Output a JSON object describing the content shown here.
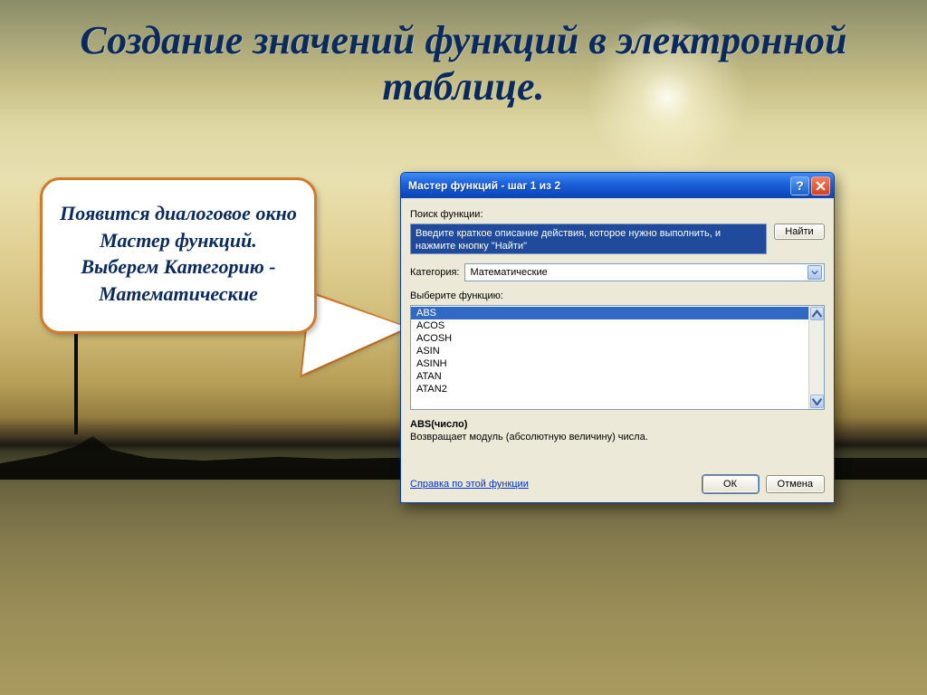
{
  "slide": {
    "title": "Создание значений функций в электронной таблице."
  },
  "bubble": {
    "text": "Появится диалоговое окно Мастер функций. Выберем Категорию - Математические"
  },
  "dialog": {
    "title": "Мастер функций - шаг 1 из 2",
    "search_label": "Поиск функции:",
    "search_text": "Введите краткое описание действия, которое нужно выполнить, и нажмите кнопку \"Найти\"",
    "find_button": "Найти",
    "category_label": "Категория:",
    "category_value": "Математические",
    "select_label": "Выберите функцию:",
    "functions": [
      "ABS",
      "ACOS",
      "ACOSH",
      "ASIN",
      "ASINH",
      "ATAN",
      "ATAN2"
    ],
    "selected_function_index": 0,
    "desc_title": "ABS(число)",
    "desc_text": "Возвращает модуль (абсолютную величину) числа.",
    "help_link": "Справка по этой функции",
    "ok": "ОК",
    "cancel": "Отмена"
  }
}
